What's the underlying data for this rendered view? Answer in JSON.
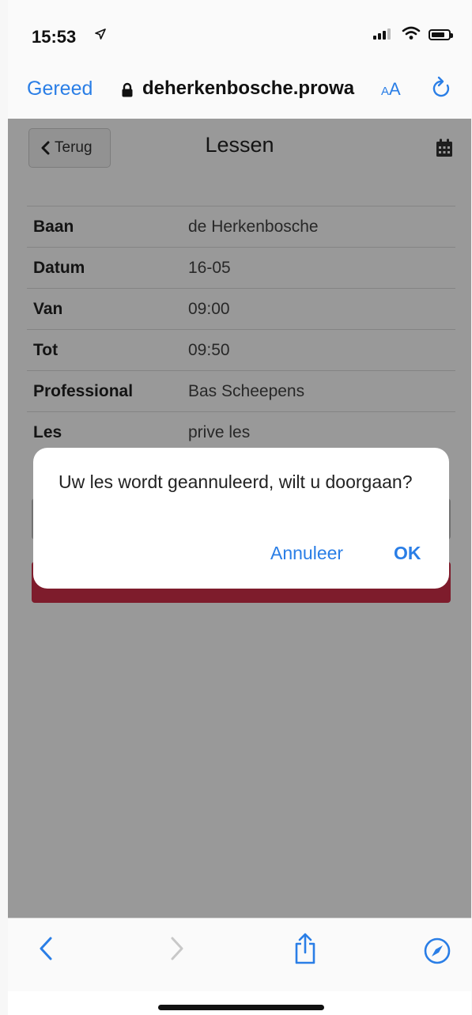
{
  "status_bar": {
    "time": "15:53"
  },
  "browser": {
    "done_label": "Gereed",
    "url": "deherkenbosche.prowa",
    "text_size_small": "A",
    "text_size_big": "A"
  },
  "page": {
    "back_label": "Terug",
    "title": "Lessen",
    "details": [
      {
        "key": "Baan",
        "value": "de Herkenbosche"
      },
      {
        "key": "Datum",
        "value": "16-05"
      },
      {
        "key": "Van",
        "value": "09:00"
      },
      {
        "key": "Tot",
        "value": "09:50"
      },
      {
        "key": "Professional",
        "value": "Bas Scheepens"
      },
      {
        "key": "Les",
        "value": "prive les"
      }
    ]
  },
  "alert": {
    "message": "Uw les wordt geannuleerd, wilt u doorgaan?",
    "cancel_label": "Annuleer",
    "ok_label": "OK"
  },
  "colors": {
    "accent": "#2a7ee6",
    "danger_button": "#d2304a"
  }
}
